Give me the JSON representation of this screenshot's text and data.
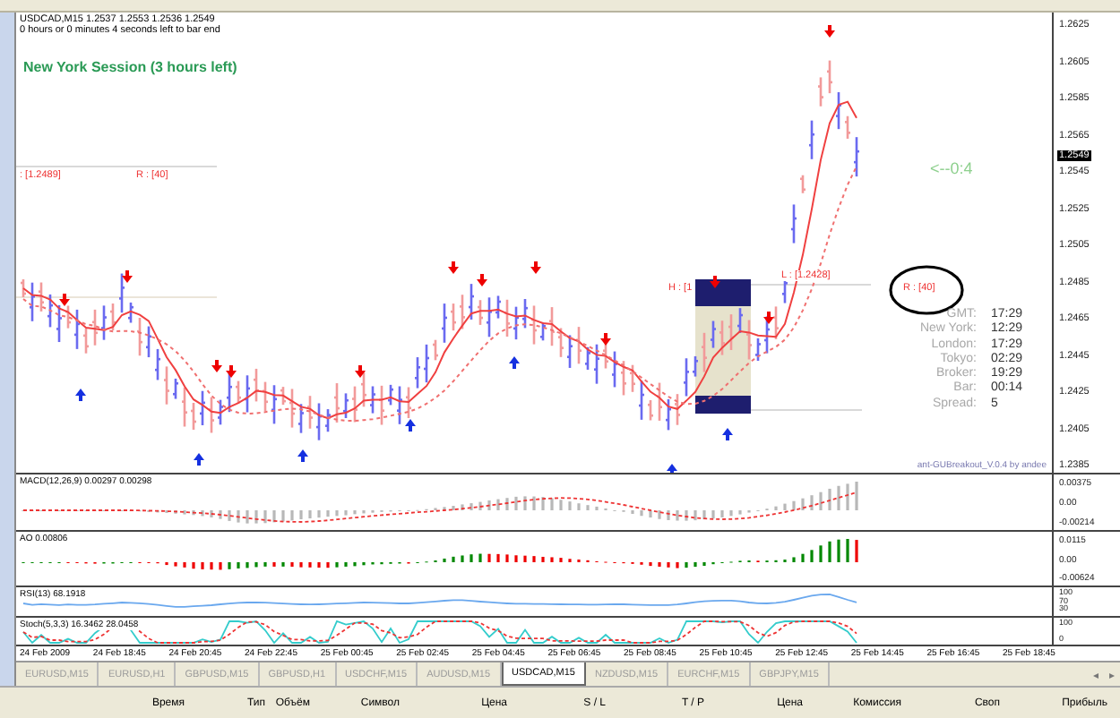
{
  "chart": {
    "symbol_line": "USDCAD,M15  1.2537 1.2553 1.2536 1.2549",
    "timer_line": "0 hours or 0 minutes 4 seconds left to bar end",
    "session_label": "New York Session (3 hours left)",
    "countdown_marker": "<--0:4",
    "range_labels": [
      {
        "text": ": [1.2489]",
        "circled": false
      },
      {
        "text": "R : [40]",
        "circled": false
      },
      {
        "text": "H : [1",
        "circled": false
      },
      {
        "text": "L : [1.2428]",
        "circled": false
      },
      {
        "text": "R : [40]",
        "circled": true
      }
    ]
  },
  "price_axis": {
    "ticks": [
      "1.2625",
      "1.2605",
      "1.2585",
      "1.2565",
      "1.2545",
      "1.2525",
      "1.2505",
      "1.2485",
      "1.2465",
      "1.2445",
      "1.2425",
      "1.2405",
      "1.2385"
    ],
    "current_price": "1.2549"
  },
  "clock_panel": {
    "rows": [
      {
        "label": "GMT:",
        "value": "17:29"
      },
      {
        "label": "New York:",
        "value": "12:29"
      },
      {
        "label": "London:",
        "value": "17:29"
      },
      {
        "label": "Tokyo:",
        "value": "02:29"
      },
      {
        "label": "Broker:",
        "value": "19:29"
      },
      {
        "label": "Bar:",
        "value": "00:14"
      },
      {
        "label": "Spread:",
        "value": "5"
      }
    ],
    "footer": "ant-GUBreakout_V.0.4 by andee"
  },
  "indicators": [
    {
      "kind": "macd",
      "title": "MACD(12,26,9) 0.00297 0.00298",
      "axis": [
        "0.00375",
        "0.00",
        "-0.00214"
      ]
    },
    {
      "kind": "ao",
      "title": "AO 0.00806",
      "axis": [
        "0.0115",
        "0.00",
        "-0.00624"
      ]
    },
    {
      "kind": "rsi",
      "title": "RSI(13) 68.1918",
      "axis": [
        "100",
        "70",
        "30"
      ]
    },
    {
      "kind": "stoch",
      "title": "Stoch(5,3,3) 16.3462 28.0458",
      "axis": [
        "100",
        "0"
      ]
    }
  ],
  "time_axis": [
    "24 Feb 2009",
    "24 Feb 18:45",
    "24 Feb 20:45",
    "24 Feb 22:45",
    "25 Feb 00:45",
    "25 Feb 02:45",
    "25 Feb 04:45",
    "25 Feb 06:45",
    "25 Feb 08:45",
    "25 Feb 10:45",
    "25 Feb 12:45",
    "25 Feb 14:45",
    "25 Feb 16:45",
    "25 Feb 18:45"
  ],
  "tabs": [
    {
      "label": "EURUSD,M15",
      "selected": false
    },
    {
      "label": "EURUSD,H1",
      "selected": false
    },
    {
      "label": "GBPUSD,M15",
      "selected": false
    },
    {
      "label": "GBPUSD,H1",
      "selected": false
    },
    {
      "label": "USDCHF,M15",
      "selected": false
    },
    {
      "label": "AUDUSD,M15",
      "selected": false
    },
    {
      "label": "USDCAD,M15",
      "selected": true
    },
    {
      "label": "NZDUSD,M15",
      "selected": false
    },
    {
      "label": "EURCHF,M15",
      "selected": false
    },
    {
      "label": "GBPJPY,M15",
      "selected": false
    }
  ],
  "tab_scroll": [
    "◂",
    "▸"
  ],
  "trade_columns": [
    "Время",
    "Тип",
    "Объём",
    "Символ",
    "Цена",
    "S / L",
    "T / P",
    "Цена",
    "Комиссия",
    "Своп",
    "Прибыль"
  ]
}
